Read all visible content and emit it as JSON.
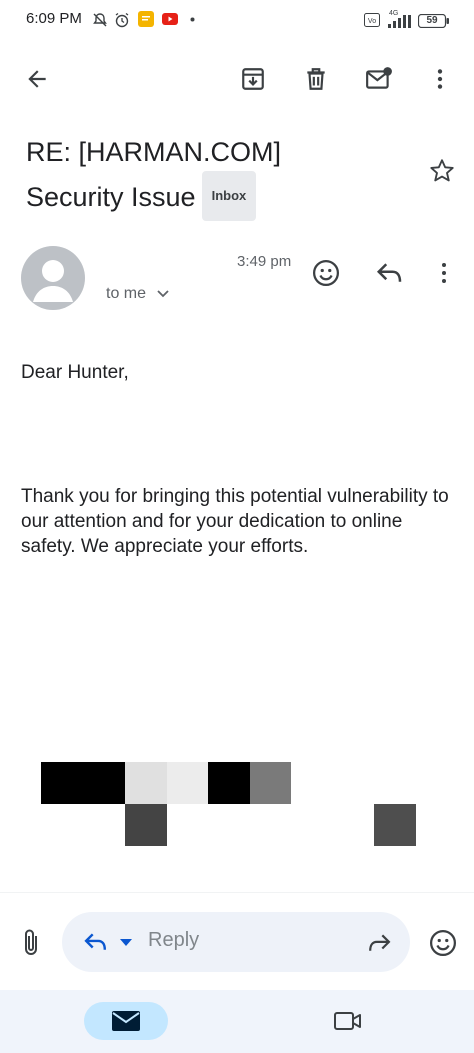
{
  "status_bar": {
    "time": "6:09 PM",
    "battery": "59",
    "network": "4G",
    "icons": [
      "muted-bell-icon",
      "alarm-icon",
      "notes-app-icon",
      "youtube-icon",
      "dot-icon",
      "volte-icon",
      "signal-icon",
      "battery-icon"
    ]
  },
  "toolbar": {
    "icons": [
      "back-arrow-icon",
      "archive-icon",
      "delete-icon",
      "mark-unread-icon",
      "more-vert-icon"
    ]
  },
  "email": {
    "subject": "RE: [HARMAN.COM] Security Issue",
    "label": "Inbox",
    "time": "3:49 pm",
    "recipient": "to me",
    "greeting": "Dear Hunter,",
    "body": "Thank you for bringing this potential vulnerability to our attention and for your dedication to online safety. We appreciate your efforts."
  },
  "reply_bar": {
    "reply_label": "Reply"
  },
  "colors": {
    "accent": "#0b57d0",
    "mail_pill": "#c3e7ff",
    "nav_bg": "#f0f4fb",
    "reply_bg": "#eef2f9"
  }
}
